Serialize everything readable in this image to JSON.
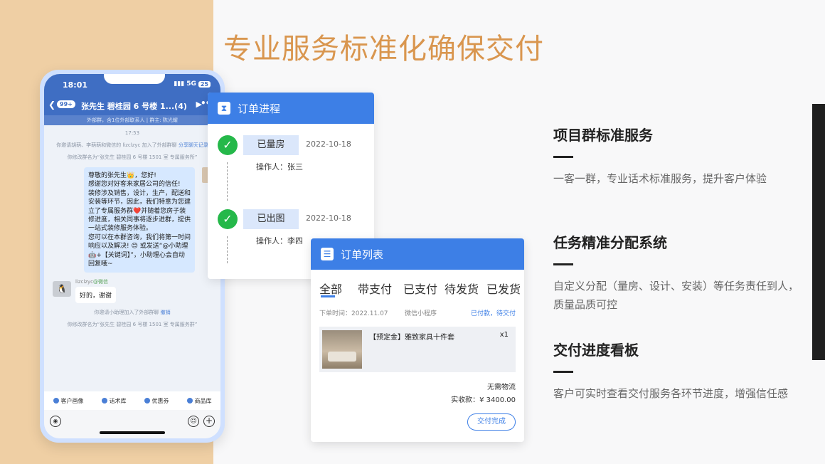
{
  "title": "专业服务标准化确保交付",
  "phone": {
    "time": "18:01",
    "signal": "5G",
    "battery": "25",
    "unread_badge": "99+",
    "chat_title": "张先生 碧桂园 6 号楼 1...(4)",
    "chat_subtitle": "外部群，含1位外部联系人 | 群主: 陈光耀",
    "timestamp": "17:53",
    "sys_invite": "你邀请胡萌、李萌萌和微信的 lizclzyc 加入了外部群聊",
    "sys_invite_link": "分享聊天记录",
    "sys_rename": "你修改群名为“张先生 碧桂园 6 号楼 1501 室 专属服务所”",
    "welcome_message": "尊敬的张先生👑，您好!\n感谢您对好客来家居公司的信任!\n装修涉及销售，设计，生产，配送和安装等环节，因此，我们特意为您建立了专属服务群❤️并随着您房子装修进度，相关同事将逐步进群，提供一站式装修服务体验。\n您可以在本群咨询，我们将第一时间响应以及解决! 😊 或发送“@小助理🤖+【关键词】”，小助理心会自动回复哦~",
    "sender_name": "lizclzyc",
    "sender_tag": "@微信",
    "reply": "好的，谢谢",
    "sys_invite2": "你邀请小助理加入了外部群聊",
    "sys_invite2_link": "撤销",
    "sys_rename2": "你修改群名为“张先生 碧桂园 6 号楼 1501 室 专属服务群”",
    "quick_actions": [
      "客户画像",
      "话术库",
      "优惠券",
      "商品库"
    ]
  },
  "order_progress": {
    "title": "订单进程",
    "steps": [
      {
        "status": "已量房",
        "date": "2022-10-18",
        "operator": "操作人：张三"
      },
      {
        "status": "已出图",
        "date": "2022-10-18",
        "operator": "操作人：李四"
      }
    ]
  },
  "order_list": {
    "title": "订单列表",
    "tabs": [
      "全部",
      "带支付",
      "已支付",
      "待发货",
      "已发货"
    ],
    "order_time": "下单时间：2022.11.07",
    "channel": "微信小程序",
    "order_state": "已付款，待交付",
    "product_name": "【预定金】雅致家具十件套",
    "quantity": "x1",
    "shipping": "无需物流",
    "paid": "实收款：¥ 3400.00",
    "action": "交付完成"
  },
  "features": [
    {
      "title": "项目群标准服务",
      "desc": "一客一群，专业话术标准服务，提升客户体验"
    },
    {
      "title": "任务精准分配系统",
      "desc": "自定义分配（量房、设计、安装）等任务责任到人，质量品质可控"
    },
    {
      "title": "交付进度看板",
      "desc": "客户可实时查看交付服务各环节进度，增强信任感"
    }
  ],
  "colors": {
    "left_band": "#efcfa4",
    "title": "#d9964f",
    "brand_blue": "#3d7fe6",
    "success_green": "#25b84a"
  }
}
